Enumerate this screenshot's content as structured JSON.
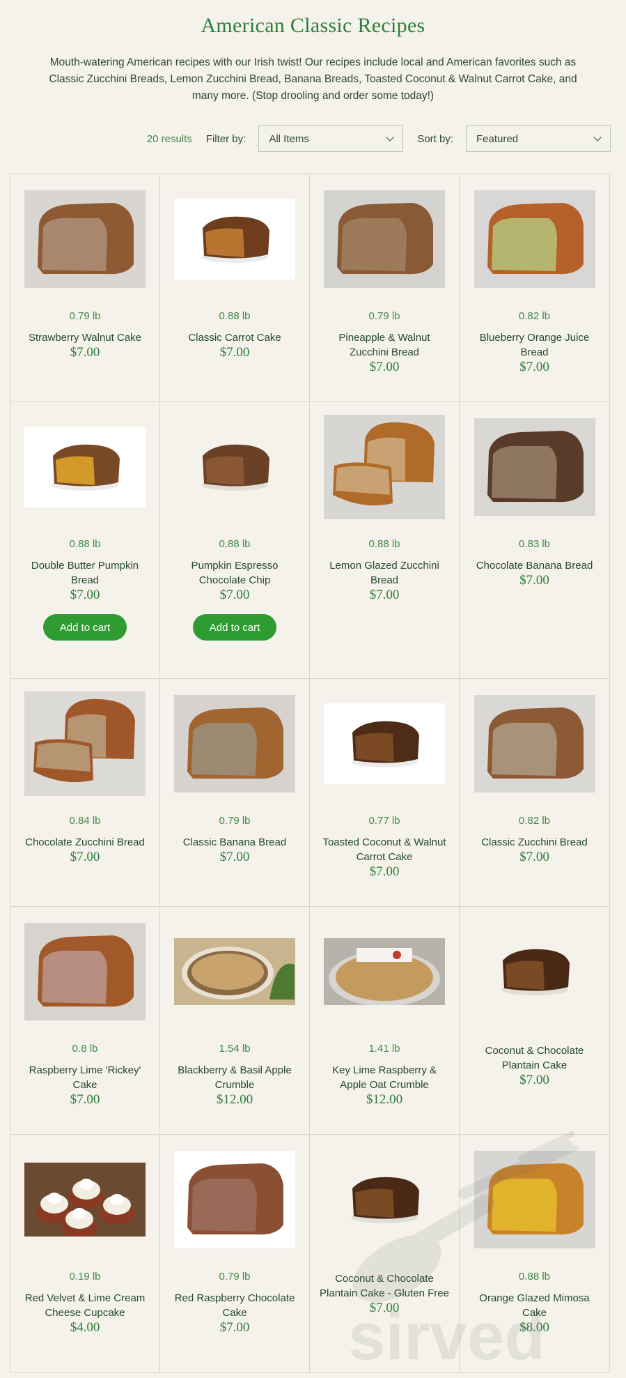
{
  "page": {
    "title": "American Classic Recipes",
    "intro": "Mouth-watering American recipes with our Irish twist! Our recipes include local and American favorites such as Classic Zucchini Breads, Lemon Zucchini Bread, Banana Breads, Toasted Coconut & Walnut Carrot Cake, and many more. (Stop drooling and order some today!)"
  },
  "controls": {
    "results": "20 results",
    "filter_label": "Filter by:",
    "filter_value": "All Items",
    "sort_label": "Sort by:",
    "sort_value": "Featured"
  },
  "watermark": "sirved",
  "products": [
    {
      "weight": "0.79 lb",
      "name": "Strawberry Walnut Cake",
      "price": "$7.00",
      "img": {
        "bg": "#d9d6d2",
        "crust": "#8e5a34",
        "crumb": "#a9876f",
        "shape": "loaf"
      }
    },
    {
      "weight": "0.88 lb",
      "name": "Classic Carrot Cake",
      "price": "$7.00",
      "img": {
        "bg": "#ffffff",
        "crust": "#6e3d1e",
        "crumb": "#b9742f",
        "shape": "small"
      }
    },
    {
      "weight": "0.79 lb",
      "name": "Pineapple & Walnut Zucchini Bread",
      "price": "$7.00",
      "img": {
        "bg": "#d5d3cf",
        "crust": "#8a5a36",
        "crumb": "#9c7a5a",
        "shape": "loaf"
      }
    },
    {
      "weight": "0.82 lb",
      "name": "Blueberry Orange Juice Bread",
      "price": "$7.00",
      "img": {
        "bg": "#d8d7d5",
        "crust": "#b5612a",
        "crumb": "#b6b570",
        "shape": "loaf"
      }
    },
    {
      "weight": "0.88 lb",
      "name": "Double Butter Pumpkin Bread",
      "price": "$7.00",
      "button": "Add to cart",
      "img": {
        "bg": "#ffffff",
        "crust": "#7a4a26",
        "crumb": "#d39a2a",
        "shape": "small"
      }
    },
    {
      "weight": "0.88 lb",
      "name": "Pumpkin Espresso Chocolate Chip",
      "price": "$7.00",
      "button": "Add to cart",
      "img": {
        "bg": "#f4f2ea",
        "crust": "#6b4126",
        "crumb": "#8a5734",
        "shape": "small"
      }
    },
    {
      "weight": "0.88 lb",
      "name": "Lemon Glazed Zucchini Bread",
      "price": "$7.00",
      "img": {
        "bg": "#d8d6d2",
        "crust": "#b06a2a",
        "crumb": "#c9a273",
        "shape": "sliced"
      }
    },
    {
      "weight": "0.83 lb",
      "name": "Chocolate Banana Bread",
      "price": "$7.00",
      "img": {
        "bg": "#d9d7d4",
        "crust": "#5a3a28",
        "crumb": "#8f7661",
        "shape": "loaf"
      }
    },
    {
      "weight": "0.84 lb",
      "name": "Chocolate Zucchini Bread",
      "price": "$7.00",
      "img": {
        "bg": "#dcdad6",
        "crust": "#a0572a",
        "crumb": "#b59572",
        "shape": "sliced"
      }
    },
    {
      "weight": "0.79 lb",
      "name": "Classic Banana Bread",
      "price": "$7.00",
      "img": {
        "bg": "#d6d3cf",
        "crust": "#a06531",
        "crumb": "#9c8a73",
        "shape": "loaf"
      }
    },
    {
      "weight": "0.77 lb",
      "name": "Toasted Coconut & Walnut Carrot Cake",
      "price": "$7.00",
      "img": {
        "bg": "#ffffff",
        "crust": "#4e2c18",
        "crumb": "#7b4a24",
        "shape": "small"
      }
    },
    {
      "weight": "0.82 lb",
      "name": "Classic Zucchini Bread",
      "price": "$7.00",
      "img": {
        "bg": "#dad8d4",
        "crust": "#8c5a35",
        "crumb": "#a8927a",
        "shape": "loaf"
      }
    },
    {
      "weight": "0.8 lb",
      "name": "Raspberry Lime 'Rickey' Cake",
      "price": "$7.00",
      "img": {
        "bg": "#d7d4d0",
        "crust": "#a1592a",
        "crumb": "#b78d7f",
        "shape": "loaf"
      }
    },
    {
      "weight": "1.54 lb",
      "name": "Blackberry & Basil Apple Crumble",
      "price": "$12.00",
      "img": {
        "bg": "#c8b590",
        "crust": "#c9a36e",
        "crumb": "#8a6a45",
        "shape": "crumble"
      }
    },
    {
      "weight": "1.41 lb",
      "name": "Key Lime Raspberry & Apple Oat Crumble",
      "price": "$12.00",
      "img": {
        "bg": "#b5b2ab",
        "crust": "#b07a40",
        "crumb": "#c59a5e",
        "shape": "tin"
      }
    },
    {
      "weight": "",
      "name": "Coconut & Chocolate Plantain Cake",
      "price": "$7.00",
      "img": {
        "bg": "#f4f2ea",
        "crust": "#4a2a16",
        "crumb": "#7a4a24",
        "shape": "small"
      }
    },
    {
      "weight": "0.19 lb",
      "name": "Red Velvet & Lime Cream Cheese Cupcake",
      "price": "$4.00",
      "img": {
        "bg": "#6a4a30",
        "crust": "#8a3a22",
        "crumb": "#f3eee2",
        "shape": "cupcakes"
      }
    },
    {
      "weight": "0.79 lb",
      "name": "Red Raspberry Chocolate Cake",
      "price": "$7.00",
      "img": {
        "bg": "#ffffff",
        "crust": "#8a4f34",
        "crumb": "#9a6a58",
        "shape": "loaf"
      }
    },
    {
      "weight": "",
      "name": "Coconut & Chocolate Plantain Cake - Gluten Free",
      "price": "$7.00",
      "img": {
        "bg": "#f4f2ea",
        "crust": "#4a2a16",
        "crumb": "#7a4a24",
        "shape": "small"
      }
    },
    {
      "weight": "0.88 lb",
      "name": "Orange Glazed Mimosa Cake",
      "price": "$8.00",
      "img": {
        "bg": "#d8d6d3",
        "crust": "#c7822a",
        "crumb": "#e1b32a",
        "shape": "loaf"
      }
    }
  ]
}
